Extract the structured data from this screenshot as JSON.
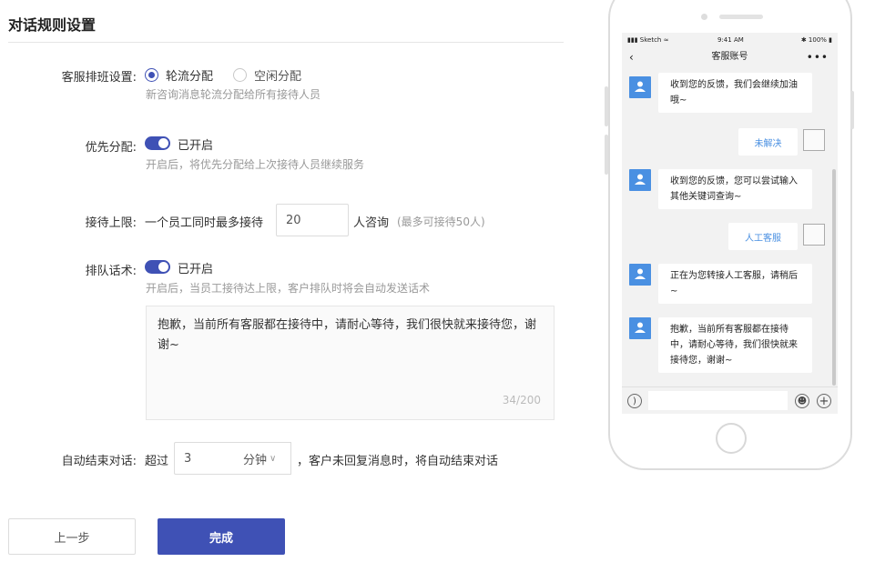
{
  "page": {
    "title": "对话规则设置"
  },
  "assign": {
    "label": "客服排班设置:",
    "option_rotate": "轮流分配",
    "option_idle": "空闲分配",
    "hint": "新咨询消息轮流分配给所有接待人员"
  },
  "priority": {
    "label": "优先分配:",
    "status": "已开启",
    "hint": "开启后，将优先分配给上次接待人员继续服务"
  },
  "limit": {
    "label": "接待上限:",
    "prefix": "一个员工同时最多接待",
    "value": "20",
    "suffix": "人咨询",
    "note": "(最多可接待50人)"
  },
  "queue": {
    "label": "排队话术:",
    "status": "已开启",
    "hint": "开启后，当员工接待达上限，客户排队时将会自动发送话术",
    "message": "抱歉，当前所有客服都在接待中，请耐心等待，我们很快就来接待您，谢谢~",
    "counter": "34/200"
  },
  "auto_end": {
    "label": "自动结束对话:",
    "prefix": "超过",
    "value": "3",
    "unit": "分钟",
    "suffix": "，客户未回复消息时，将自动结束对话"
  },
  "buttons": {
    "prev": "上一步",
    "done": "完成"
  },
  "phone": {
    "carrier": "Sketch",
    "time": "9:41 AM",
    "battery": "100%",
    "nav_title": "客服账号",
    "messages": [
      "收到您的反馈，我们会继续加油哦~",
      "收到您的反馈，您可以尝试输入其他关键词查询~",
      "正在为您转接人工客服，请稍后~",
      "抱歉，当前所有客服都在接待中，请耐心等待，我们很快就来接待您，谢谢~"
    ],
    "replies": [
      "未解决",
      "人工客服"
    ]
  },
  "colors": {
    "accent": "#3f51b5",
    "phone_accent": "#4a90e2"
  }
}
